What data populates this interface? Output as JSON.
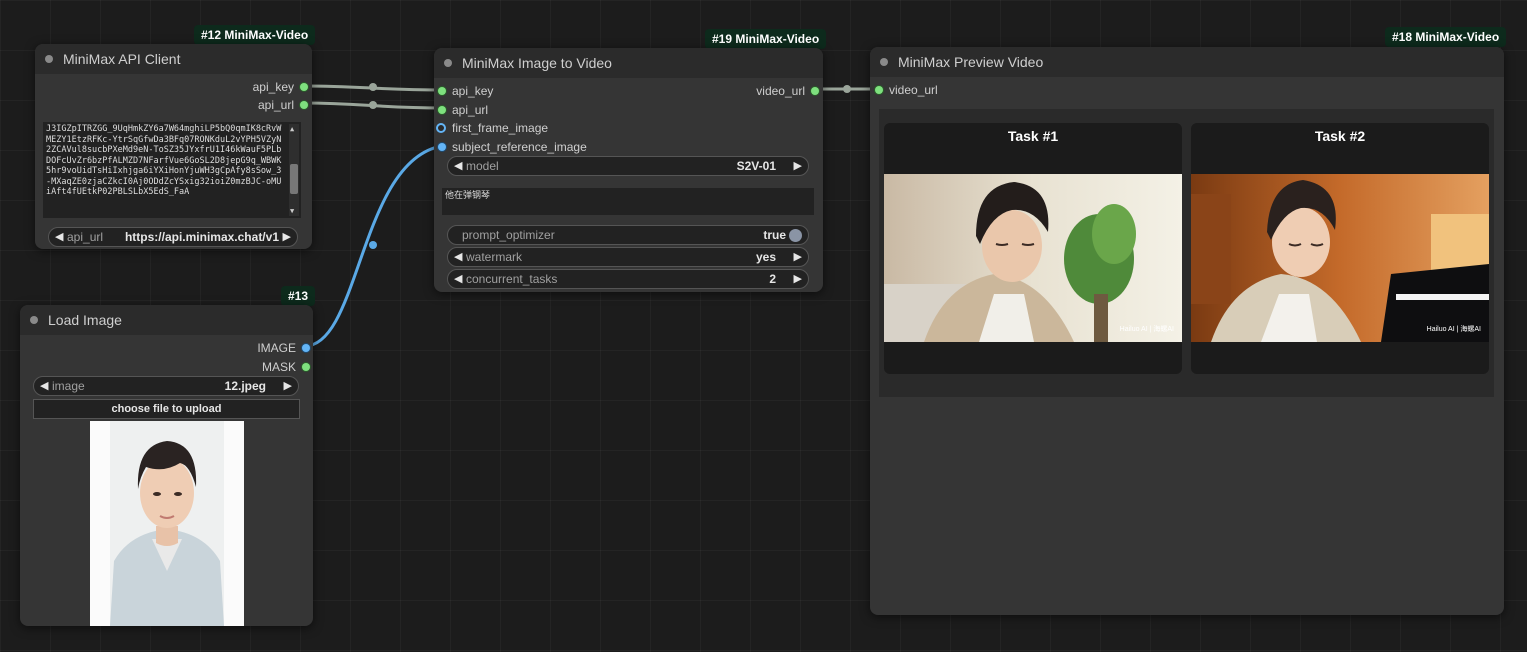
{
  "nodes": {
    "api_client": {
      "badge": "#12 MiniMax-Video",
      "title": "MiniMax API Client",
      "outputs": [
        "api_key",
        "api_url"
      ],
      "api_key_text": "J3IGZpITRZGG_9UqHmkZY6a7W64mghiLP5bQ0qmIK8cRvWMEZY1EtzRFKc-YtrSqGfwDa3BFq07RONKduL2vYPH5VZyN2ZCAVul8sucbPXeMd9eN-ToSZ35JYxfrU1I46kWauF5PLbDOFcUvZr6bzPfALMZD7NFarfVue6GoSL2D8jepG9q_WBWK5hr9voUidTsHiIxhjga6iYXiHonYjuWH3gCpAfy8sSow_3-MXaqZE0zjaCZkcI0Aj0ODdZcYSxig32ioiZ0mzBJC-oMUiAft4fUEtkP02PBLSLbX5EdS_FaA",
      "url_widget": {
        "label": "api_url",
        "value": "https://api.minimax.chat/v1"
      }
    },
    "load_image": {
      "badge": "#13",
      "title": "Load Image",
      "outputs": [
        "IMAGE",
        "MASK"
      ],
      "image_widget": {
        "label": "image",
        "value": "12.jpeg"
      },
      "upload_label": "choose file to upload"
    },
    "image_to_video": {
      "badge": "#19 MiniMax-Video",
      "title": "MiniMax Image to Video",
      "inputs": [
        "api_key",
        "api_url",
        "first_frame_image",
        "subject_reference_image"
      ],
      "outputs": [
        "video_url"
      ],
      "model": {
        "label": "model",
        "value": "S2V-01"
      },
      "prompt": "他在弹钢琴",
      "prompt_optimizer": {
        "label": "prompt_optimizer",
        "value": "true"
      },
      "watermark": {
        "label": "watermark",
        "value": "yes"
      },
      "concurrent_tasks": {
        "label": "concurrent_tasks",
        "value": "2"
      }
    },
    "preview": {
      "badge": "#18 MiniMax-Video",
      "title": "MiniMax Preview Video",
      "inputs": [
        "video_url"
      ],
      "tasks": [
        {
          "title": "Task #1",
          "watermark_text": "Hailuo AI | 海螺AI"
        },
        {
          "title": "Task #2",
          "watermark_text": "Hailuo AI | 海螺AI"
        }
      ]
    }
  },
  "colors": {
    "canvas": "#1c1c1c",
    "node_bg": "#353535",
    "title_bg": "#2b2b2b",
    "badge_bg": "#0d2a1c",
    "socket_green": "#7ee07e",
    "socket_blue": "#64b5f6",
    "link_gray": "#9aa59a",
    "link_blue": "#5aa9e6"
  }
}
